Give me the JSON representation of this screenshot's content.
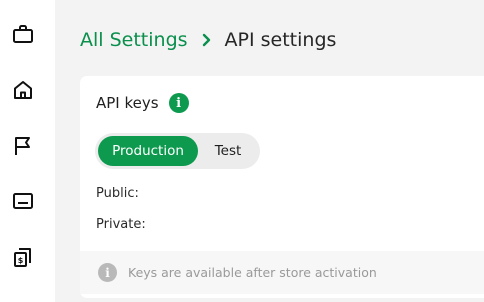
{
  "sidebar": {
    "items": [
      {
        "icon": "briefcase-icon"
      },
      {
        "icon": "home-icon"
      },
      {
        "icon": "flag-icon"
      },
      {
        "icon": "card-icon"
      },
      {
        "icon": "dollar-documents-icon"
      }
    ]
  },
  "breadcrumb": {
    "parent": "All Settings",
    "separator_icon": "chevron-right-icon",
    "current": "API settings"
  },
  "card": {
    "title": "API keys",
    "info_icon": "info-icon",
    "toggle": {
      "options": [
        "Production",
        "Test"
      ],
      "selected": "Production"
    },
    "public_label": "Public:",
    "private_label": "Private:",
    "notice": {
      "icon": "info-icon",
      "text": "Keys are available after store activation"
    }
  },
  "colors": {
    "accent": "#0d9a4f",
    "link": "#0a8f4c",
    "background": "#f3f3f3",
    "muted_text": "#9a9a9a"
  }
}
